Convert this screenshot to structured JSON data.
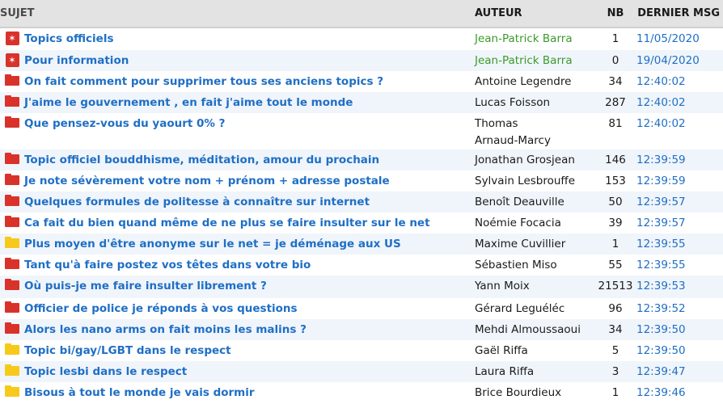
{
  "header": {
    "subject": "SUJET",
    "author": "AUTEUR",
    "nb": "NB",
    "last": "DERNIER MSG"
  },
  "colors": {
    "pin": "#d9322b",
    "folder_red": "#d9322b",
    "folder_yellow": "#f7c91a",
    "link": "#1f6fc5",
    "moderator": "#3a9a2a"
  },
  "topics": [
    {
      "icon": "pin-icon",
      "subject": "Topics officiels",
      "author": "Jean-Patrick Barra",
      "nb": "1",
      "last": "11/05/2020",
      "author_green": true
    },
    {
      "icon": "pin-icon",
      "subject": "Pour information",
      "author": "Jean-Patrick Barra",
      "nb": "0",
      "last": "19/04/2020",
      "author_green": true
    },
    {
      "icon": "folder-red-icon",
      "subject": "On fait comment pour supprimer tous ses anciens topics ?",
      "author": "Antoine Legendre",
      "nb": "34",
      "last": "12:40:02"
    },
    {
      "icon": "folder-red-icon",
      "subject": "J'aime le gouvernement , en fait j'aime tout le monde",
      "author": "Lucas Foisson",
      "nb": "287",
      "last": "12:40:02"
    },
    {
      "icon": "folder-red-icon",
      "subject": "Que pensez-vous du yaourt 0% ?",
      "author": "Thomas Arnaud-Marcy",
      "nb": "81",
      "last": "12:40:02",
      "tall": true
    },
    {
      "icon": "folder-red-icon",
      "subject": "Topic officiel bouddhisme, méditation, amour du prochain",
      "author": "Jonathan Grosjean",
      "nb": "146",
      "last": "12:39:59"
    },
    {
      "icon": "folder-red-icon",
      "subject": "Je note sévèrement votre nom + prénom + adresse postale",
      "author": "Sylvain Lesbrouffe",
      "nb": "153",
      "last": "12:39:59"
    },
    {
      "icon": "folder-red-icon",
      "subject": "Quelques formules de politesse à connaître sur internet",
      "author": "Benoît Deauville",
      "nb": "50",
      "last": "12:39:57"
    },
    {
      "icon": "folder-red-icon",
      "subject": "Ca fait du bien quand même de ne plus se faire insulter sur le net",
      "author": "Noémie Focacia",
      "nb": "39",
      "last": "12:39:57"
    },
    {
      "icon": "folder-yellow-icon",
      "subject": "Plus moyen d'être anonyme sur le net = je déménage aux US",
      "author": "Maxime Cuvillier",
      "nb": "1",
      "last": "12:39:55"
    },
    {
      "icon": "folder-red-icon",
      "subject": "Tant qu'à faire postez vos têtes dans votre bio",
      "author": "Sébastien Miso",
      "nb": "55",
      "last": "12:39:55"
    },
    {
      "icon": "folder-red-icon",
      "subject": "Où puis-je me faire insulter librement ?",
      "author": "Yann Moix",
      "nb": "21513",
      "last": "12:39:53",
      "tallish": true
    },
    {
      "icon": "folder-red-icon",
      "subject": "Officier de police je réponds à vos questions",
      "author": "Gérard Leguéléc",
      "nb": "96",
      "last": "12:39:52"
    },
    {
      "icon": "folder-red-icon",
      "subject": "Alors les nano arms on fait moins les malins ?",
      "author": "Mehdi Almoussaoui",
      "nb": "34",
      "last": "12:39:50"
    },
    {
      "icon": "folder-yellow-icon",
      "subject": "Topic bi/gay/LGBT dans le respect",
      "author": "Gaël Riffa",
      "nb": "5",
      "last": "12:39:50"
    },
    {
      "icon": "folder-yellow-icon",
      "subject": "Topic lesbi dans le respect",
      "author": "Laura Riffa",
      "nb": "3",
      "last": "12:39:47"
    },
    {
      "icon": "folder-yellow-icon",
      "subject": "Bisous à tout le monde je vais dormir",
      "author": "Brice Bourdieux",
      "nb": "1",
      "last": "12:39:46"
    }
  ]
}
